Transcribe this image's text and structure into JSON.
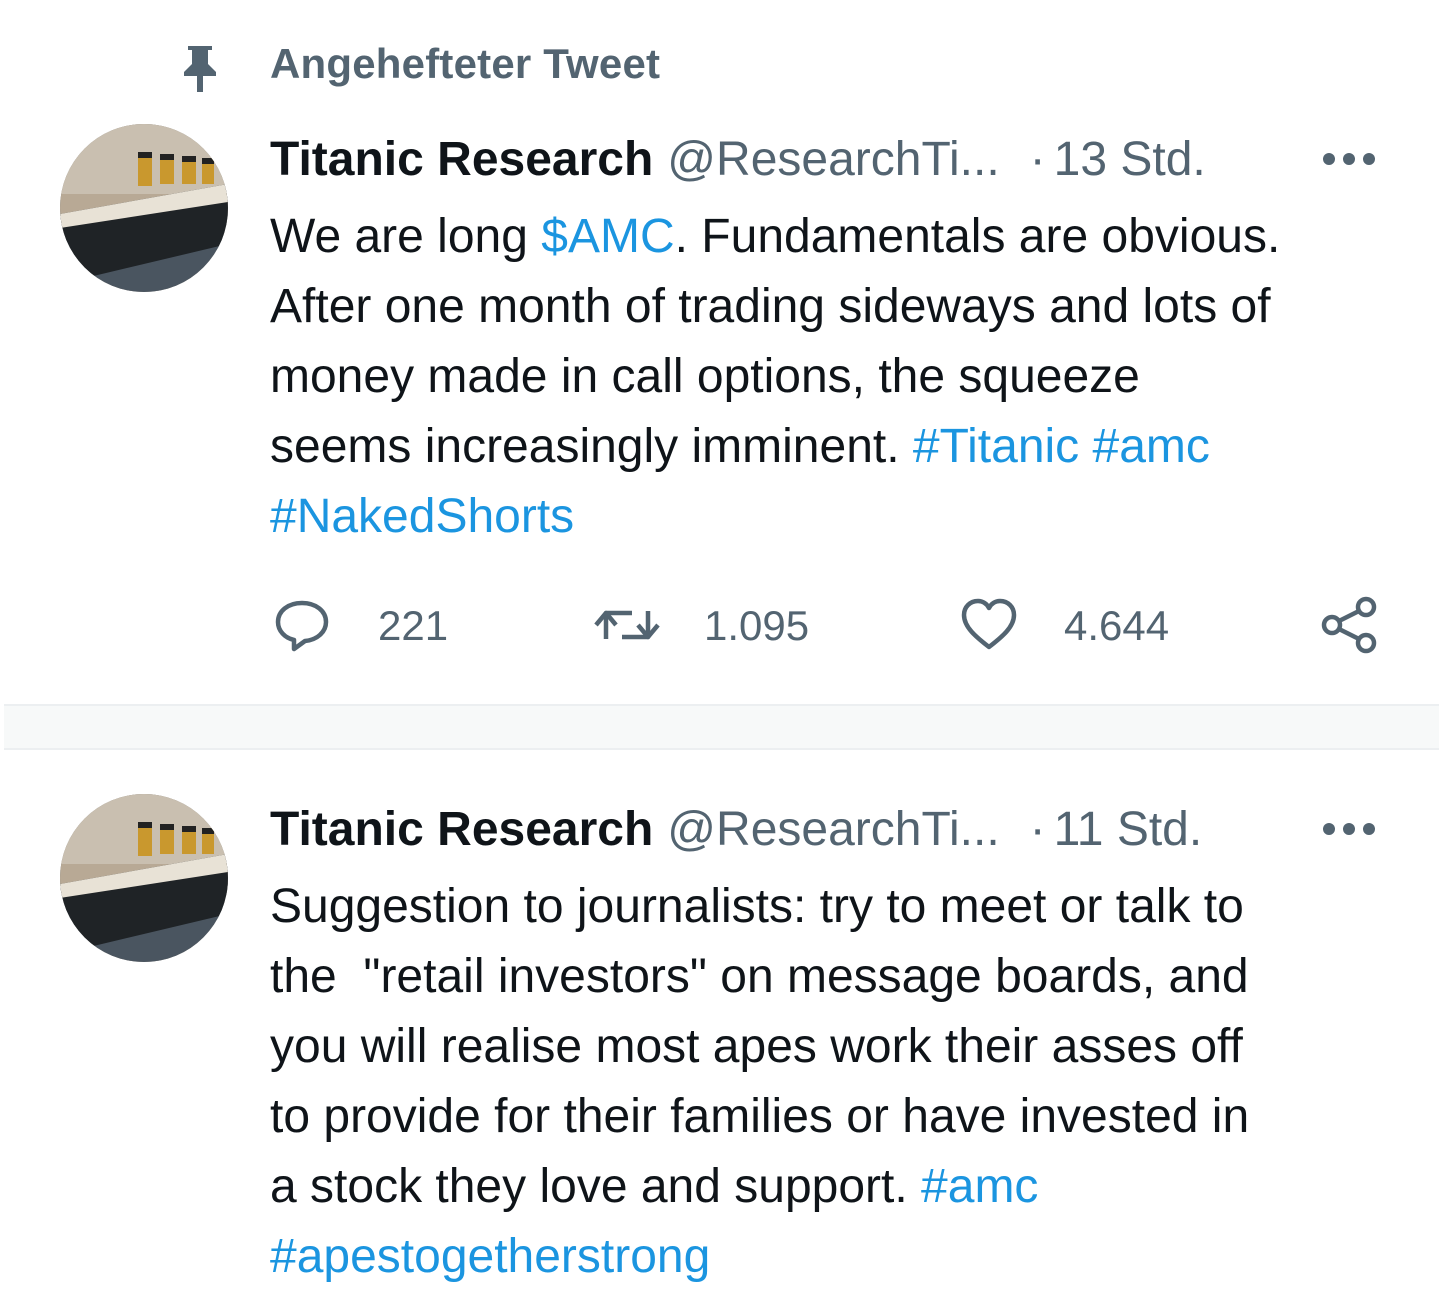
{
  "pinned": {
    "label": "Angehefteter Tweet"
  },
  "tweets": [
    {
      "author": "Titanic Research",
      "handle": "@ResearchTi...",
      "separator": "·",
      "time": "13 Std.",
      "text_lines": [
        [
          "We are long ",
          "$AMC",
          ". Fundamentals are obvious."
        ],
        [
          "After one month of trading sideways and lots of"
        ],
        [
          "money made in call options, the squeeze"
        ],
        [
          "seems increasingly imminent. ",
          "#Titanic",
          " ",
          "#amc"
        ],
        [
          "#NakedShorts"
        ]
      ],
      "stats": {
        "replies": "221",
        "retweets": "1.095",
        "likes": "4.644"
      }
    },
    {
      "author": "Titanic Research",
      "handle": "@ResearchTi...",
      "separator": "·",
      "time": "11 Std.",
      "text_lines": [
        [
          "Suggestion to journalists: try to meet or talk to"
        ],
        [
          "the  \"retail investors\" on message boards, and"
        ],
        [
          "you will realise most apes work their asses off"
        ],
        [
          "to provide for their families or have invested in"
        ],
        [
          "a stock they love and support. ",
          "#amc"
        ],
        [
          "#apestogetherstrong"
        ]
      ]
    }
  ],
  "icons": {
    "pin": "pin-icon",
    "more": "more-icon",
    "reply": "reply-icon",
    "retweet": "retweet-icon",
    "like": "heart-icon",
    "share": "share-icon"
  },
  "colors": {
    "link": "#1b95e0",
    "secondary_text": "#536471",
    "primary_text": "#0f1419"
  }
}
